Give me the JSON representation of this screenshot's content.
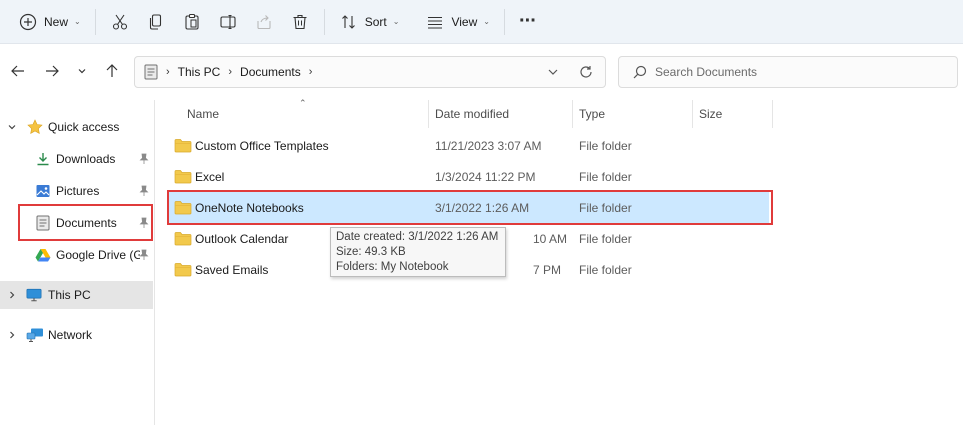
{
  "toolbar": {
    "new_label": "New",
    "sort_label": "Sort",
    "view_label": "View",
    "more_label": "···"
  },
  "breadcrumb": {
    "items": [
      "This PC",
      "Documents"
    ]
  },
  "search": {
    "placeholder": "Search Documents"
  },
  "sidebar": {
    "quick_access": "Quick access",
    "items": [
      {
        "label": "Downloads",
        "icon": "download-icon"
      },
      {
        "label": "Pictures",
        "icon": "pictures-icon"
      },
      {
        "label": "Documents",
        "icon": "documents-icon"
      },
      {
        "label": "Google Drive (G",
        "icon": "google-drive-icon"
      }
    ],
    "this_pc": "This PC",
    "network": "Network"
  },
  "columns": {
    "name": "Name",
    "date_modified": "Date modified",
    "type": "Type",
    "size": "Size"
  },
  "files": [
    {
      "name": "Custom Office Templates",
      "date": "11/21/2023 3:07 AM",
      "type": "File folder"
    },
    {
      "name": "Excel",
      "date": "1/3/2024 11:22 PM",
      "type": "File folder"
    },
    {
      "name": "OneNote Notebooks",
      "date": "3/1/2022 1:26 AM",
      "type": "File folder"
    },
    {
      "name": "Outlook Calendar",
      "date": "10 AM",
      "type": "File folder"
    },
    {
      "name": "Saved Emails",
      "date": "7 PM",
      "type": "File folder"
    }
  ],
  "tooltip": {
    "line1": "Date created: 3/1/2022 1:26 AM",
    "line2": "Size: 49.3 KB",
    "line3": "Folders: My Notebook"
  },
  "colors": {
    "accent": "#0067c0",
    "selection": "#cce8ff",
    "highlight": "#e03b3b",
    "folder": "#f2c94c"
  }
}
